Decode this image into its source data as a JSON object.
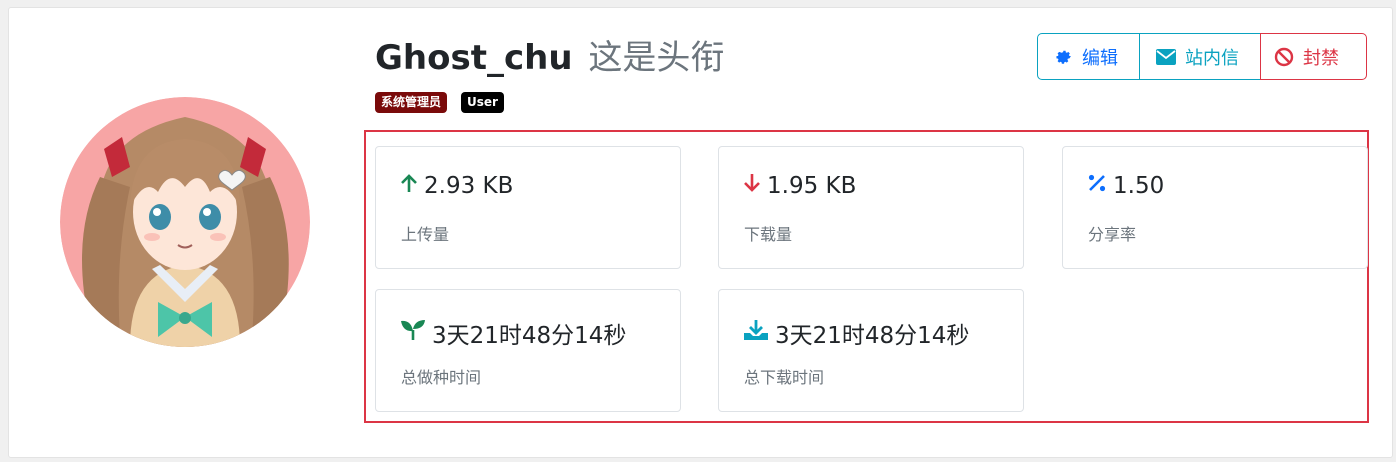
{
  "user": {
    "name": "Ghost_chu",
    "subtitle": "这是头衔",
    "badges": [
      {
        "label": "系统管理员",
        "color": "#7a0a0a"
      },
      {
        "label": "User",
        "color": "#000000"
      }
    ]
  },
  "actions": {
    "edit_label": "编辑",
    "message_label": "站内信",
    "ban_label": "封禁"
  },
  "stats": [
    {
      "value": "2.93 KB",
      "label": "上传量",
      "icon": "arrow-up-icon",
      "color": "#198754"
    },
    {
      "value": "1.95 KB",
      "label": "下载量",
      "icon": "arrow-down-icon",
      "color": "#dc3545"
    },
    {
      "value": "1.50",
      "label": "分享率",
      "icon": "percent-icon",
      "color": "#0d6efd"
    },
    {
      "value": "3天21时48分14秒",
      "label": "总做种时间",
      "icon": "seedling-icon",
      "color": "#198754"
    },
    {
      "value": "3天21时48分14秒",
      "label": "总下载时间",
      "icon": "download-tray-icon",
      "color": "#0aa2c0"
    }
  ],
  "colors": {
    "primary": "#0d6efd",
    "info": "#0aa2c0",
    "danger": "#dc3545",
    "success": "#198754",
    "muted": "#6c757d"
  }
}
